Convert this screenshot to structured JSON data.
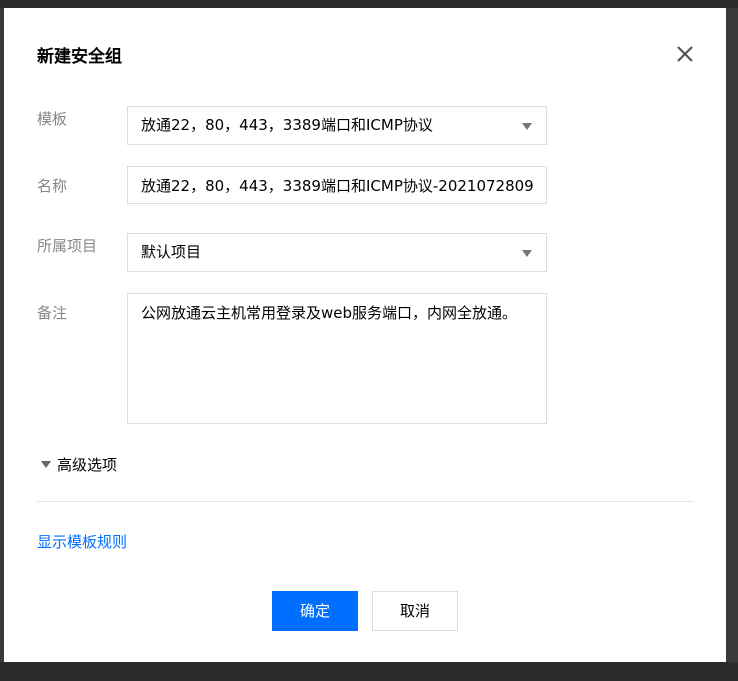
{
  "dialog": {
    "title": "新建安全组"
  },
  "form": {
    "template": {
      "label": "模板",
      "value": "放通22，80，443，3389端口和ICMP协议"
    },
    "name": {
      "label": "名称",
      "value": "放通22，80，443，3389端口和ICMP协议-2021072809"
    },
    "project": {
      "label": "所属项目",
      "value": "默认项目"
    },
    "remark": {
      "label": "备注",
      "value": "公网放通云主机常用登录及web服务端口，内网全放通。"
    }
  },
  "advanced_options": "高级选项",
  "show_rules_link": "显示模板规则",
  "buttons": {
    "confirm": "确定",
    "cancel": "取消"
  },
  "colors": {
    "primary": "#006eff",
    "link": "#006eff",
    "label": "#888888"
  },
  "icons": {
    "close": "close-icon",
    "dropdown": "caret-down-icon",
    "expand": "triangle-down-icon"
  }
}
